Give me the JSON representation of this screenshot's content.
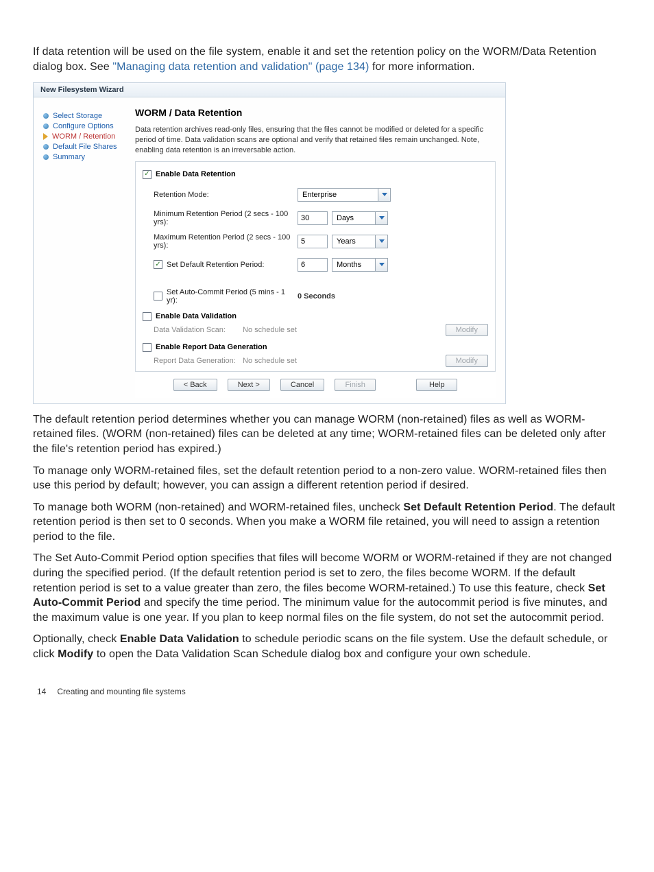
{
  "intro": {
    "text_before_link": "If data retention will be used on the file system, enable it and set the retention policy on the WORM/Data Retention dialog box. See ",
    "link_text": "\"Managing data retention and validation\" (page 134)",
    "text_after_link": " for more information."
  },
  "screenshot": {
    "window_title": "New Filesystem Wizard",
    "nav": {
      "items": [
        {
          "label": "Select Storage",
          "style": "dot"
        },
        {
          "label": "Configure Options",
          "style": "dot"
        },
        {
          "label": "WORM / Retention",
          "style": "arrow"
        },
        {
          "label": "Default File Shares",
          "style": "dot"
        },
        {
          "label": "Summary",
          "style": "dot"
        }
      ]
    },
    "main": {
      "heading": "WORM / Data Retention",
      "description": "Data retention archives read-only files, ensuring that the files cannot be modified or deleted for a specific period of time. Data validation scans are optional and verify that retained files remain unchanged. Note, enabling data retention is an irreversable action.",
      "enable_retention_label": "Enable Data Retention",
      "enable_retention_checked": true,
      "retention_mode_label": "Retention Mode:",
      "retention_mode_value": "Enterprise",
      "min_period_label": "Minimum Retention Period (2 secs - 100 yrs):",
      "min_period_value": "30",
      "min_period_unit": "Days",
      "max_period_label": "Maximum Retention Period (2 secs - 100 yrs):",
      "max_period_value": "5",
      "max_period_unit": "Years",
      "default_period_cb_checked": true,
      "default_period_label": "Set Default Retention Period:",
      "default_period_value": "6",
      "default_period_unit": "Months",
      "autocommit_cb_checked": false,
      "autocommit_label": "Set Auto-Commit Period (5 mins - 1 yr):",
      "autocommit_value_display": "0 Seconds",
      "enable_validation_cb_checked": false,
      "enable_validation_label": "Enable Data Validation",
      "validation_scan_lbl": "Data Validation Scan:",
      "validation_scan_val": "No schedule set",
      "modify_label": "Modify",
      "enable_report_cb_checked": false,
      "enable_report_label": "Enable Report Data Generation",
      "report_gen_lbl": "Report Data Generation:",
      "report_gen_val": "No schedule set"
    },
    "footer": {
      "back": "< Back",
      "next": "Next >",
      "cancel": "Cancel",
      "finish": "Finish",
      "help": "Help"
    }
  },
  "body_paras": {
    "p1": "The default retention period determines whether you can manage WORM (non-retained) files as well as WORM-retained files. (WORM (non-retained) files can be deleted at any time; WORM-retained files can be deleted only after the file's retention period has expired.)",
    "p2": "To manage only WORM-retained files, set the default retention period to a non-zero value. WORM-retained files then use this period by default; however, you can assign a different retention period if desired.",
    "p3_a": "To manage both WORM (non-retained) and WORM-retained files, uncheck ",
    "p3_bold": "Set Default Retention Period",
    "p3_b": ". The default retention period is then set to 0 seconds. When you make a WORM file retained, you will need to assign a retention period to the file.",
    "p4_a": "The Set Auto-Commit Period option specifies that files will become WORM or WORM-retained if they are not changed during the specified period. (If the default retention period is set to zero, the files become WORM. If the default retention period is set to a value greater than zero, the files become WORM-retained.) To use this feature, check ",
    "p4_bold": "Set Auto-Commit Period",
    "p4_b": " and specify the time period. The minimum value for the autocommit period is five minutes, and the maximum value is one year. If you plan to keep normal files on the file system, do not set the autocommit period.",
    "p5_a": "Optionally, check ",
    "p5_bold1": "Enable Data Validation",
    "p5_b": " to schedule periodic scans on the file system. Use the default schedule, or click ",
    "p5_bold2": "Modify",
    "p5_c": " to open the Data Validation Scan Schedule dialog box and configure your own schedule."
  },
  "footer": {
    "page_num": "14",
    "section": "Creating and mounting file systems"
  }
}
